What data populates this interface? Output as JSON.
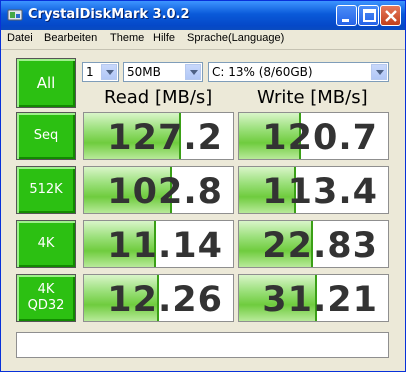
{
  "window": {
    "title": "CrystalDiskMark 3.0.2"
  },
  "menu": [
    "Datei",
    "Bearbeiten",
    "Theme",
    "Hilfe",
    "Sprache(Language)"
  ],
  "controls": {
    "all_label": "All",
    "count": "1",
    "size": "50MB",
    "drive": "C: 13% (8/60GB)"
  },
  "headers": {
    "read": "Read [MB/s]",
    "write": "Write [MB/s]"
  },
  "rows": [
    {
      "label": [
        "Seq"
      ],
      "read": "127.2",
      "write": "120.7",
      "read_fill": 0.64,
      "write_fill": 0.4
    },
    {
      "label": [
        "512K"
      ],
      "read": "102.8",
      "write": "113.4",
      "read_fill": 0.58,
      "write_fill": 0.37
    },
    {
      "label": [
        "4K"
      ],
      "read": "11.14",
      "write": "22.83",
      "read_fill": 0.47,
      "write_fill": 0.48
    },
    {
      "label": [
        "4K",
        "QD32"
      ],
      "read": "12.26",
      "write": "31.21",
      "read_fill": 0.49,
      "write_fill": 0.51
    }
  ],
  "status_text": ""
}
